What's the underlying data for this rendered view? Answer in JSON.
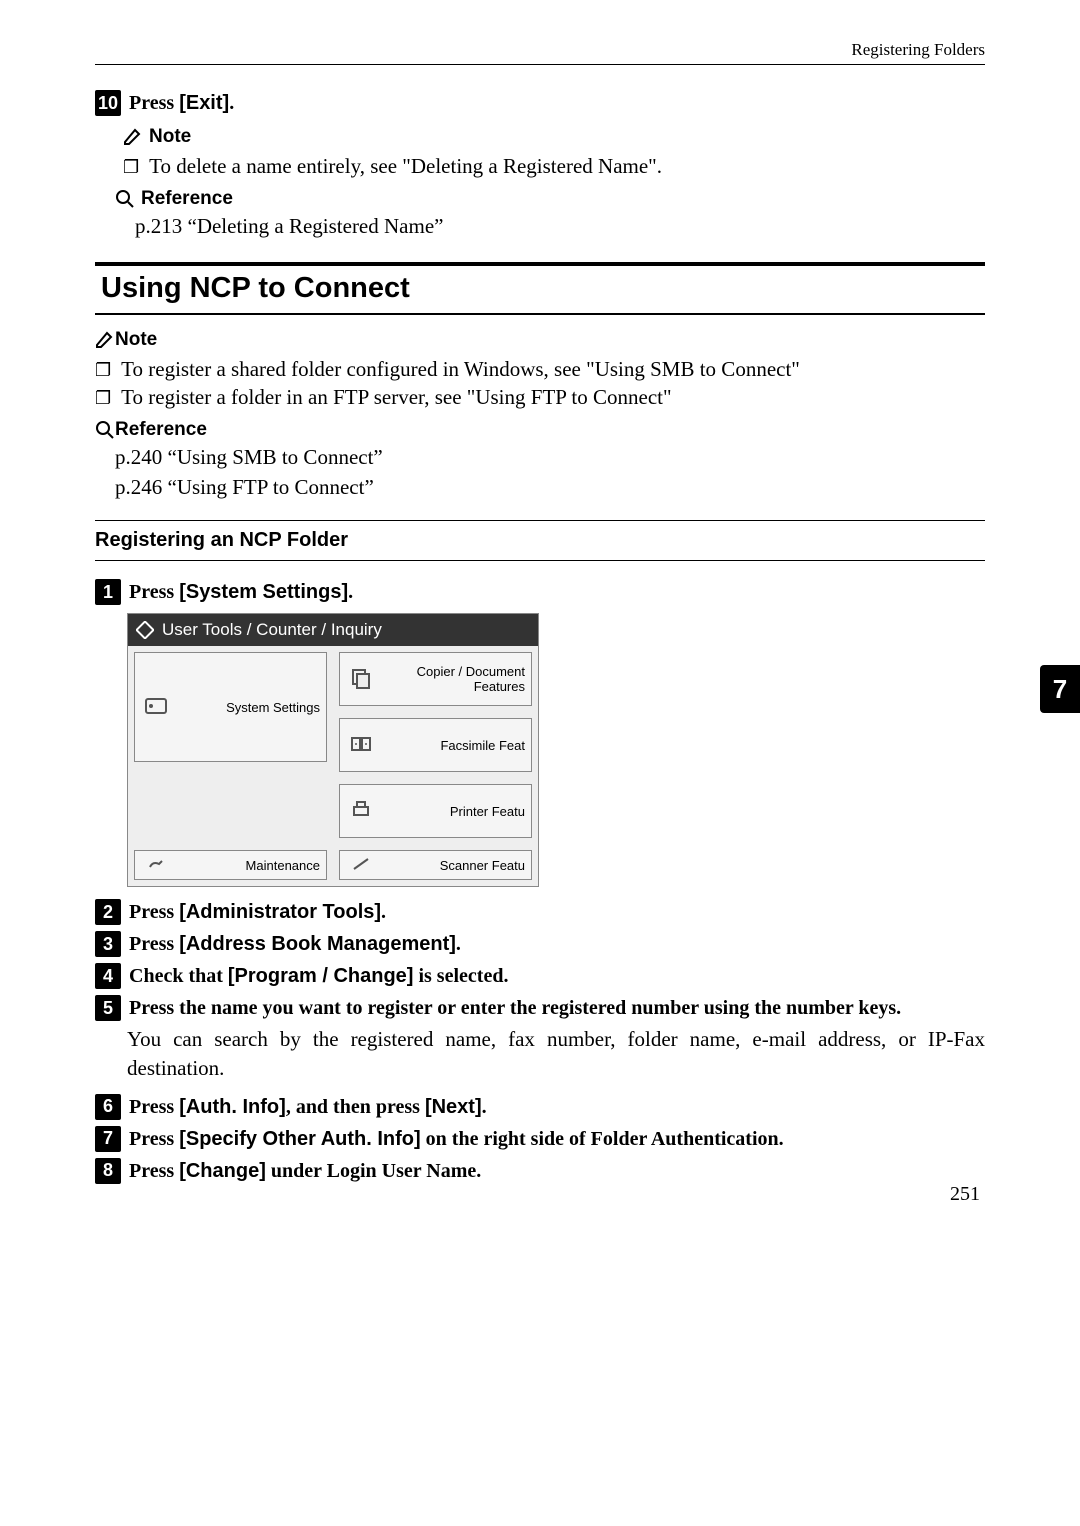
{
  "header": {
    "right": "Registering Folders"
  },
  "side_tab": "7",
  "page_number": "251",
  "step10": {
    "num": "10",
    "prefix": "Press ",
    "button": "[Exit]",
    "suffix": "."
  },
  "note1": {
    "label": "Note",
    "item": "To delete a name entirely, see \"Deleting a Registered Name\"."
  },
  "ref1": {
    "label": "Reference",
    "text": "p.213 “Deleting a Registered Name”"
  },
  "h2": "Using NCP to Connect",
  "note2": {
    "label": "Note",
    "items": [
      "To register a shared folder configured in Windows, see \"Using SMB to Connect\"",
      "To register a folder in an FTP server, see \"Using FTP to Connect\""
    ]
  },
  "ref2": {
    "label": "Reference",
    "lines": [
      "p.240 “Using SMB to Connect”",
      "p.246 “Using FTP to Connect”"
    ]
  },
  "h3": "Registering an NCP Folder",
  "steps": {
    "s1": {
      "num": "1",
      "prefix": "Press ",
      "button": "[System Settings]",
      "suffix": "."
    },
    "s2": {
      "num": "2",
      "prefix": "Press ",
      "button": "[Administrator Tools]",
      "suffix": "."
    },
    "s3": {
      "num": "3",
      "prefix": "Press ",
      "button": "[Address Book Management]",
      "suffix": "."
    },
    "s4": {
      "num": "4",
      "prefix": "Check that ",
      "button": "[Program / Change]",
      "suffix": " is selected."
    },
    "s5": {
      "num": "5",
      "text": "Press the name you want to register or enter the registered number using the number keys."
    },
    "s5_detail": "You can search by the registered name, fax number, folder name, e-mail address, or IP-Fax destination.",
    "s6": {
      "num": "6",
      "prefix": "Press ",
      "button": "[Auth. Info]",
      "mid": ", and then press ",
      "button2": "[Next]",
      "suffix": "."
    },
    "s7": {
      "num": "7",
      "prefix": "Press ",
      "button": "[Specify Other Auth. Info]",
      "suffix": " on the right side of Folder Authentication."
    },
    "s8": {
      "num": "8",
      "prefix": "Press ",
      "button": "[Change]",
      "suffix": " under Login User Name."
    }
  },
  "screenshot": {
    "title": "User Tools / Counter / Inquiry",
    "system_settings": "System Settings",
    "copier": "Copier / Document Features",
    "fax": "Facsimile Feat",
    "printer": "Printer Featu",
    "maintenance": "Maintenance",
    "scanner": "Scanner Featu"
  }
}
